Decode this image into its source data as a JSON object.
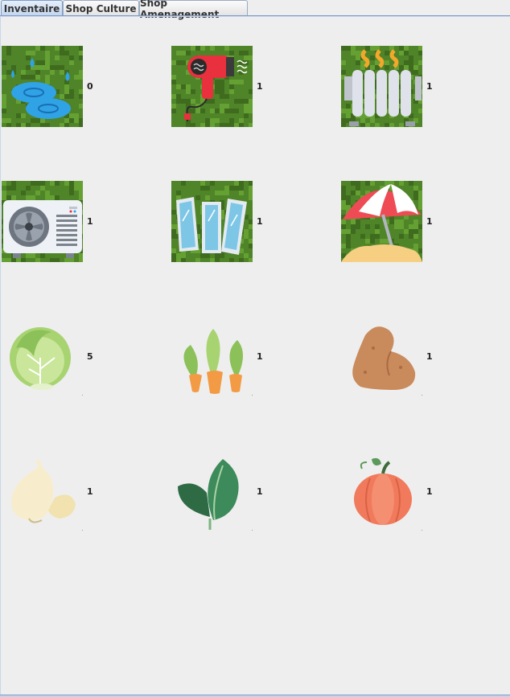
{
  "tabs": [
    {
      "label": "Inventaire",
      "selected": true
    },
    {
      "label": "Shop Culture",
      "selected": false
    },
    {
      "label": "Shop Amenagement",
      "selected": false
    }
  ],
  "inventory": [
    {
      "name": "watering",
      "icon": "water-puddle-icon",
      "count": "0"
    },
    {
      "name": "hair-dryer",
      "icon": "hair-dryer-icon",
      "count": "1"
    },
    {
      "name": "radiator",
      "icon": "radiator-icon",
      "count": "1"
    },
    {
      "name": "air-conditioner",
      "icon": "air-conditioner-icon",
      "count": "1"
    },
    {
      "name": "greenhouse-panels",
      "icon": "glass-panels-icon",
      "count": "1"
    },
    {
      "name": "parasol",
      "icon": "beach-umbrella-icon",
      "count": "1"
    },
    {
      "name": "cabbage",
      "icon": "cabbage-icon",
      "count": "5"
    },
    {
      "name": "carrot",
      "icon": "carrots-icon",
      "count": "1"
    },
    {
      "name": "potato",
      "icon": "potato-icon",
      "count": "1"
    },
    {
      "name": "garlic",
      "icon": "garlic-icon",
      "count": "1"
    },
    {
      "name": "spinach",
      "icon": "spinach-icon",
      "count": "1"
    },
    {
      "name": "pumpkin",
      "icon": "pumpkin-icon",
      "count": "1"
    }
  ],
  "colors": {
    "grass_dark": "#3f6b1f",
    "grass_mid": "#4f8428",
    "grass_light": "#65a033",
    "selected_tab": "#c3d5ee"
  }
}
